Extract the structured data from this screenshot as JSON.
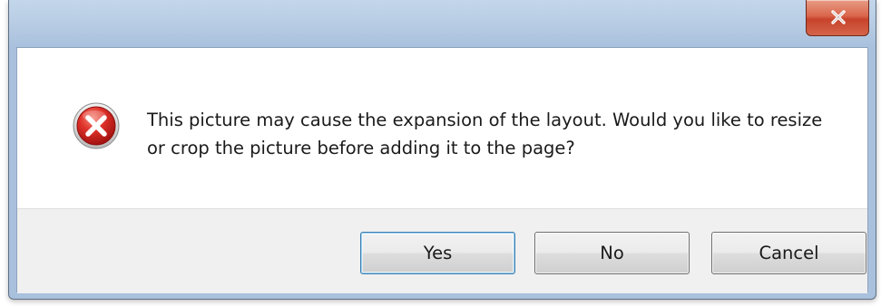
{
  "dialog": {
    "title": "",
    "message": "This picture may cause the expansion of the layout. Would you like to resize or crop the picture before adding it to the page?",
    "icon": "error-icon",
    "buttons": {
      "yes": "Yes",
      "no": "No",
      "cancel": "Cancel"
    },
    "default_button": "yes"
  },
  "titlebar": {
    "close_glyph": "x",
    "close_color": "#c7432b"
  },
  "colors": {
    "frame": "#b6cbe3",
    "button_bar": "#f0f0f0",
    "error_red": "#d8292b"
  }
}
